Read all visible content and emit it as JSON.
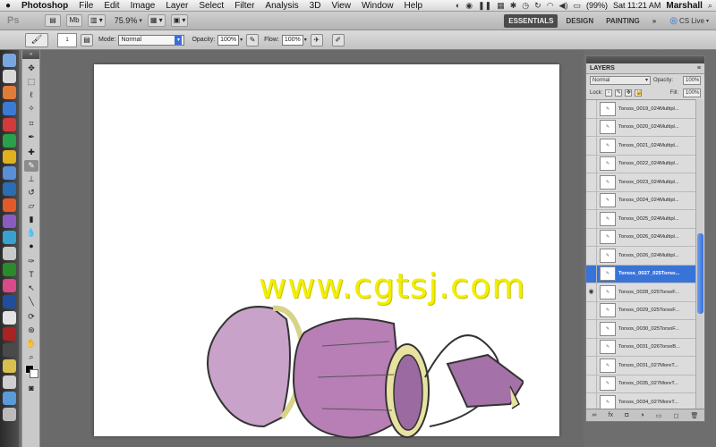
{
  "menubar": {
    "apple": "",
    "items": [
      "Photoshop",
      "File",
      "Edit",
      "Image",
      "Layer",
      "Select",
      "Filter",
      "Analysis",
      "3D",
      "View",
      "Window",
      "Help"
    ],
    "battery": "(99%)",
    "clock": "Sat 11:21 AM",
    "user": "Marshall"
  },
  "appbar": {
    "logo": "Ps",
    "mb_label": "Mb",
    "zoom": "75.9%",
    "workspaces": [
      "ESSENTIALS",
      "DESIGN",
      "PAINTING"
    ],
    "more": "»",
    "cslive": "CS Live"
  },
  "options": {
    "mode_label": "Mode:",
    "mode_value": "Normal",
    "opacity_label": "Opacity:",
    "opacity_value": "100%",
    "flow_label": "Flow:",
    "flow_value": "100%",
    "brush_size": "1"
  },
  "layers_panel": {
    "title": "LAYERS",
    "blend_mode": "Normal",
    "opacity_label": "Opacity:",
    "opacity_value": "100%",
    "lock_label": "Lock:",
    "fill_label": "Fill:",
    "fill_value": "100%",
    "layers": [
      "Torsos_0019_024Multipl...",
      "Torsos_0020_024Multipl...",
      "Torsos_0021_024Multipl...",
      "Torsos_0022_024Multipl...",
      "Torsos_0023_024Multipl...",
      "Torsos_0024_024Multipl...",
      "Torsos_0025_024Multipl...",
      "Torsos_0026_024Multipl...",
      "Torsos_0026_024Multipl...",
      "Torsos_0027_025Torso...",
      "Torsos_0028_025TorsoF...",
      "Torsos_0029_025TorsoF...",
      "Torsos_0030_025TorsoF...",
      "Torsos_0031_026TorsoB...",
      "Torsos_0031_027MoreT...",
      "Torsos_0035_027MoreT...",
      "Torsos_0034_027MoreT..."
    ],
    "selected_index": 9
  },
  "canvas": {
    "watermark": "www.cgtsj.com"
  },
  "colors": {
    "accent": "#3874d8",
    "watermark": "#f2ee00",
    "sketch_purple": "#b77fb5",
    "sketch_yellow": "#e7e2a0"
  }
}
